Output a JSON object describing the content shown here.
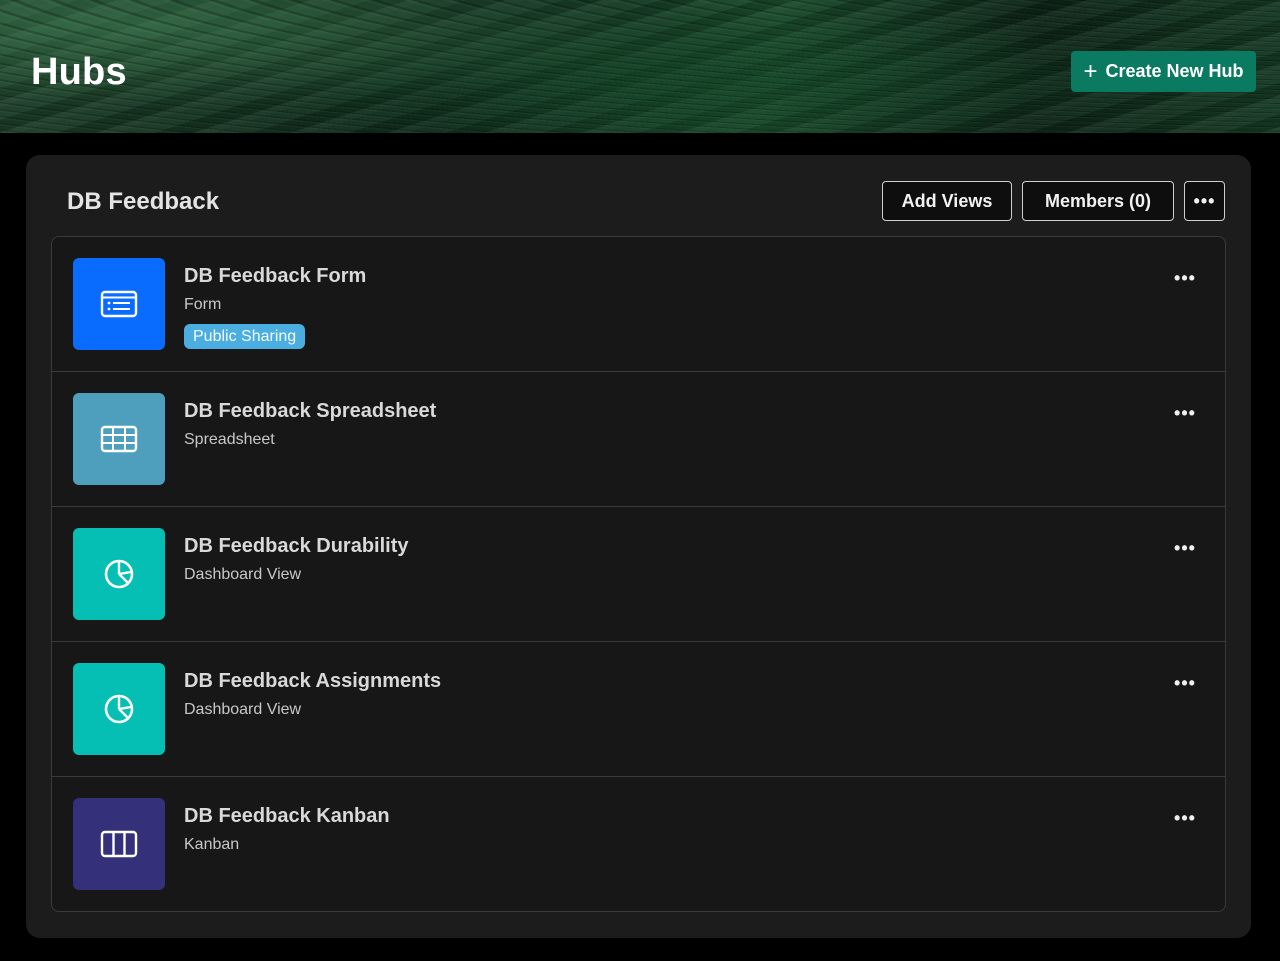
{
  "page": {
    "title": "Hubs",
    "create_button_label": "Create New Hub"
  },
  "hub": {
    "name": "DB Feedback",
    "add_views_label": "Add Views",
    "members_label": "Members (0)",
    "more_label": "•••"
  },
  "views": [
    {
      "title": "DB Feedback Form",
      "type": "Form",
      "badge": "Public Sharing",
      "icon": "form-icon",
      "color": "#0a6bff"
    },
    {
      "title": "DB Feedback Spreadsheet",
      "type": "Spreadsheet",
      "icon": "grid-icon",
      "color": "#4e9fbd"
    },
    {
      "title": "DB Feedback Durability",
      "type": "Dashboard View",
      "icon": "pie-chart-icon",
      "color": "#06bfb4"
    },
    {
      "title": "DB Feedback Assignments",
      "type": "Dashboard View",
      "icon": "pie-chart-icon",
      "color": "#06bfb4"
    },
    {
      "title": "DB Feedback Kanban",
      "type": "Kanban",
      "icon": "kanban-icon",
      "color": "#35307a"
    }
  ],
  "colors": {
    "accent": "#0a7a60",
    "panel": "#1c1c1d"
  }
}
